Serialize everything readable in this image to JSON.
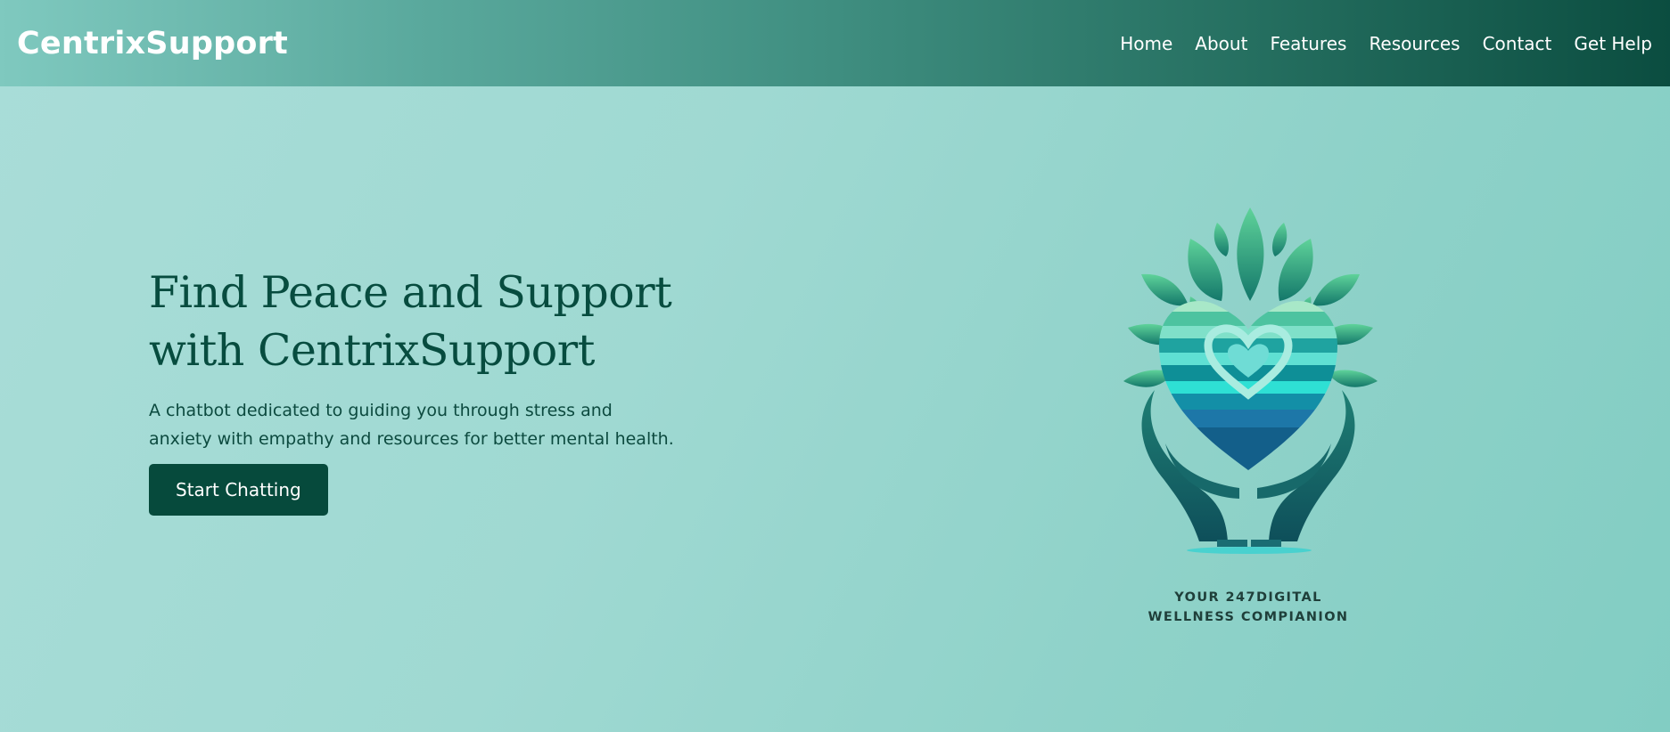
{
  "nav": {
    "brand": "CentrixSupport",
    "links": [
      "Home",
      "About",
      "Features",
      "Resources",
      "Contact",
      "Get Help"
    ]
  },
  "hero": {
    "title_line1": "Find Peace and Support",
    "title_line2": "with CentrixSupport",
    "description_line1": "A chatbot dedicated to guiding you through stress and",
    "description_line2": "anxiety with empathy and resources for better mental health.",
    "cta_label": "Start Chatting"
  },
  "logo": {
    "tagline_line1": "YOUR 247DIGITAL",
    "tagline_line2": "WELLNESS COMPIANION",
    "icon": "heart-hands-leaves-icon"
  },
  "colors": {
    "nav_start": "#7fc9bf",
    "nav_end": "#0b4d40",
    "title": "#074c3f",
    "button": "#064a3c",
    "background": "#9fd9d2"
  }
}
